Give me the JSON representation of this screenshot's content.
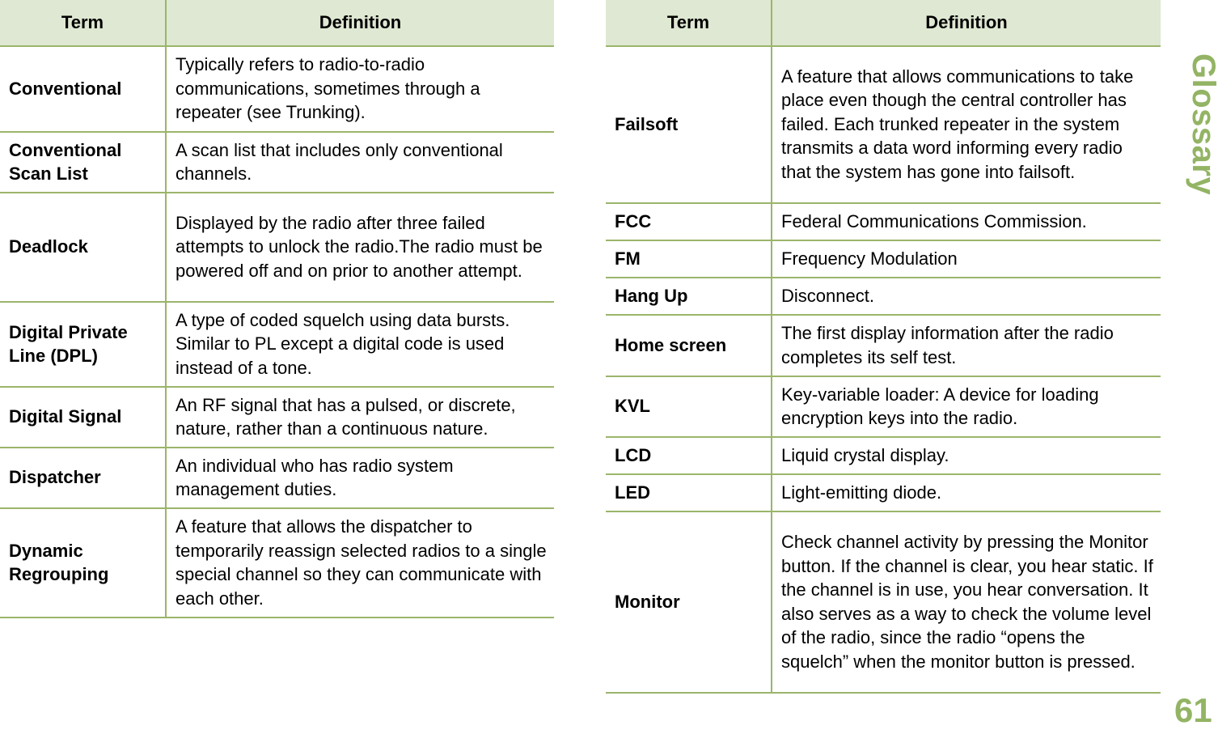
{
  "section_title": "Glossary",
  "page_number": "61",
  "colors": {
    "accent": "#93b464",
    "header_bg": "#dfe8d2",
    "rule": "#9bb56a"
  },
  "left_table": {
    "headers": {
      "term": "Term",
      "definition": "Definition"
    },
    "rows": [
      {
        "term": "Conventional",
        "definition": "Typically refers to radio-to-radio communications, sometimes through a repeater (see Trunking)."
      },
      {
        "term": "Conventional Scan List",
        "definition": "A scan list that includes only conventional channels."
      },
      {
        "term": "Deadlock",
        "definition": "Displayed by the radio after three failed attempts to unlock the radio.The radio must be powered off and on prior to another attempt."
      },
      {
        "term": "Digital Private Line (DPL)",
        "definition": "A type of coded squelch using data bursts. Similar to PL except a digital code is used instead of a tone."
      },
      {
        "term": "Digital Signal",
        "definition": "An RF signal that has a pulsed, or discrete, nature, rather than a continuous nature."
      },
      {
        "term": "Dispatcher",
        "definition": "An individual who has radio system management duties."
      },
      {
        "term": "Dynamic Regrouping",
        "definition": "A feature that allows the dispatcher to temporarily reassign selected radios to a single special channel so they can communicate with each other."
      }
    ]
  },
  "right_table": {
    "headers": {
      "term": "Term",
      "definition": "Definition"
    },
    "rows": [
      {
        "term": "Failsoft",
        "definition": "A feature that allows communications to take place even though the central controller has failed. Each trunked repeater in the system transmits a data word informing every radio that the system has gone into failsoft."
      },
      {
        "term": "FCC",
        "definition": "Federal Communications Commission."
      },
      {
        "term": "FM",
        "definition": "Frequency Modulation"
      },
      {
        "term": "Hang Up",
        "definition": "Disconnect."
      },
      {
        "term": "Home screen",
        "definition": "The first display information after the radio completes its self test."
      },
      {
        "term": "KVL",
        "definition": "Key-variable loader: A device for loading encryption keys into the radio."
      },
      {
        "term": "LCD",
        "definition": "Liquid crystal display."
      },
      {
        "term": "LED",
        "definition": "Light-emitting diode."
      },
      {
        "term": "Monitor",
        "definition": "Check channel activity by pressing the Monitor button. If the channel is clear, you hear static. If the channel is in use, you hear conversation. It also serves as a way to check the volume level of the radio, since the radio “opens the squelch” when the monitor button is pressed."
      }
    ]
  }
}
